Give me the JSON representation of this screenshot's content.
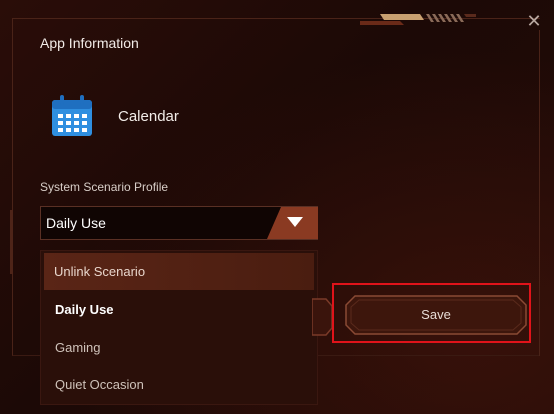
{
  "dialog": {
    "title": "App Information",
    "close_glyph": "✕"
  },
  "app": {
    "name": "Calendar",
    "icon": "calendar-icon"
  },
  "profile": {
    "label": "System Scenario Profile",
    "selected": "Daily Use",
    "options": [
      "Unlink Scenario",
      "Daily Use",
      "Gaming",
      "Quiet Occasion"
    ]
  },
  "actions": {
    "save_label": "Save"
  },
  "colors": {
    "background": "#1c0906",
    "accent": "#b3401f",
    "highlight_box": "#e0131a",
    "icon_blue": "#2f8fe0"
  }
}
